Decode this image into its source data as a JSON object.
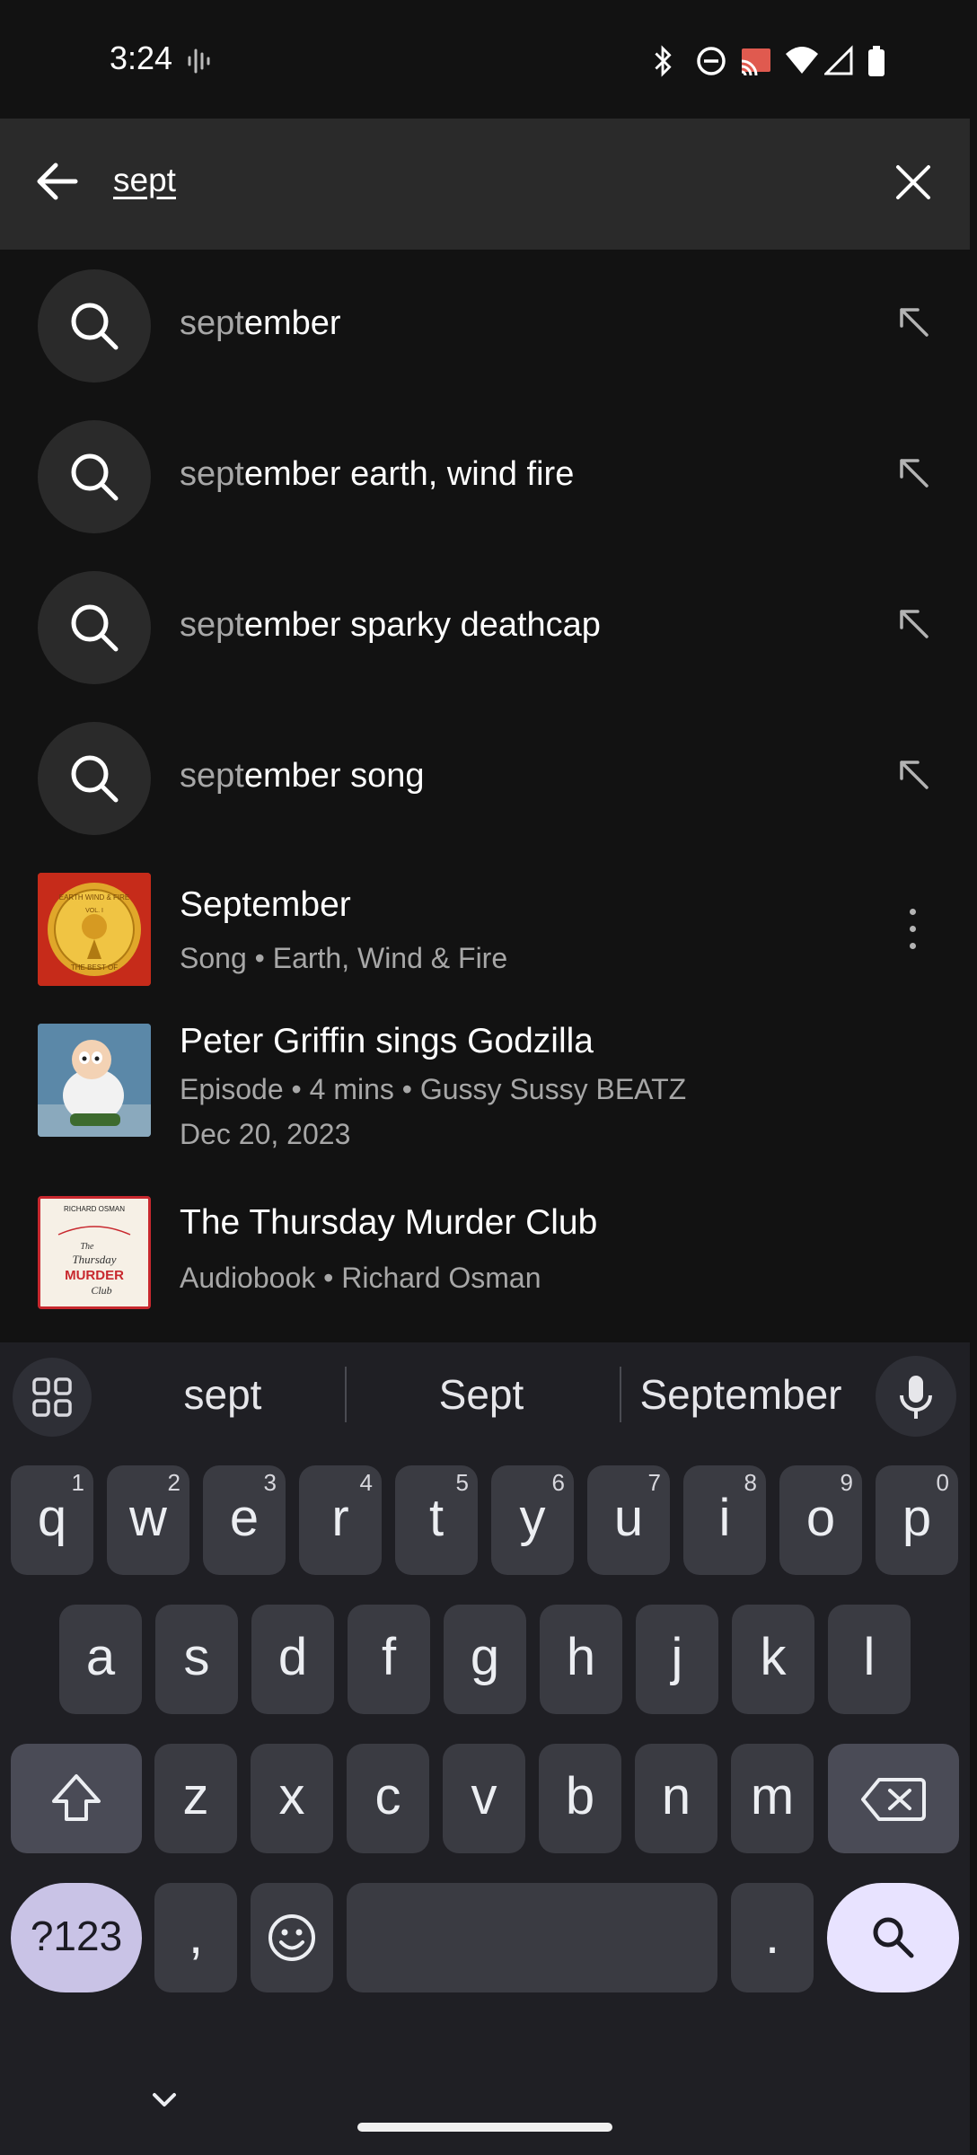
{
  "status_bar": {
    "time": "3:24"
  },
  "search": {
    "query": "sept"
  },
  "suggestions": [
    {
      "prefix": "sept",
      "rest": "ember"
    },
    {
      "prefix": "sept",
      "rest": "ember earth, wind fire"
    },
    {
      "prefix": "sept",
      "rest": "ember sparky deathcap"
    },
    {
      "prefix": "sept",
      "rest": "ember song"
    }
  ],
  "results": [
    {
      "title": "September",
      "subtitle": "Song • Earth, Wind & Fire",
      "subtitle2": ""
    },
    {
      "title": "Peter Griffin sings Godzilla",
      "subtitle": "Episode • 4 mins • Gussy Sussy BEATZ",
      "subtitle2": "Dec 20, 2023"
    },
    {
      "title": "The Thursday Murder Club",
      "subtitle": "Audiobook • Richard Osman",
      "subtitle2": ""
    }
  ],
  "album_art": {
    "top": "EARTH WIND & FIRE",
    "bottom": "THE BEST OF",
    "vol": "VOL. I"
  },
  "book_art": {
    "author": "RICHARD OSMAN",
    "line1": "The",
    "line2": "Thursday",
    "line3": "MURDER",
    "line4": "Club"
  },
  "keyboard": {
    "suggestions": [
      "sept",
      "Sept",
      "September"
    ],
    "row1": [
      {
        "k": "q",
        "n": "1"
      },
      {
        "k": "w",
        "n": "2"
      },
      {
        "k": "e",
        "n": "3"
      },
      {
        "k": "r",
        "n": "4"
      },
      {
        "k": "t",
        "n": "5"
      },
      {
        "k": "y",
        "n": "6"
      },
      {
        "k": "u",
        "n": "7"
      },
      {
        "k": "i",
        "n": "8"
      },
      {
        "k": "o",
        "n": "9"
      },
      {
        "k": "p",
        "n": "0"
      }
    ],
    "row2": [
      "a",
      "s",
      "d",
      "f",
      "g",
      "h",
      "j",
      "k",
      "l"
    ],
    "row3": [
      "z",
      "x",
      "c",
      "v",
      "b",
      "n",
      "m"
    ],
    "symbols_label": "?123",
    "comma": ",",
    "period": "."
  },
  "colors": {
    "background": "#121212",
    "header": "#2a2a2a",
    "keyboard": "#1f1f24",
    "search_key": "#e8e3ff"
  }
}
